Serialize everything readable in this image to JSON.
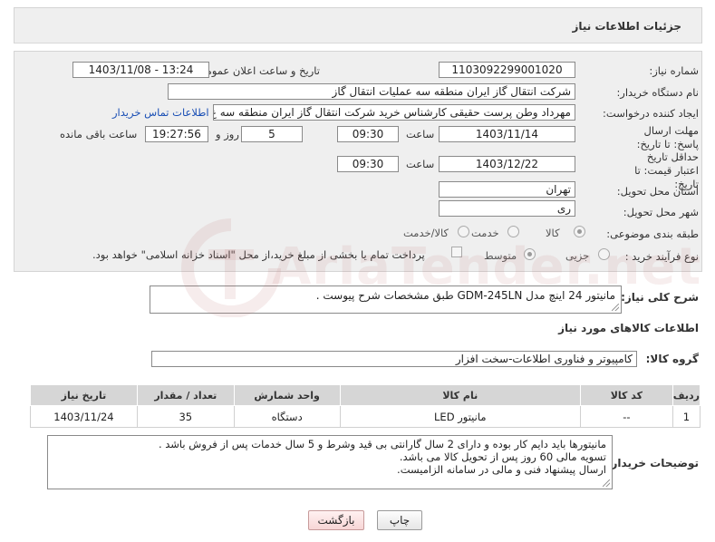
{
  "header": {
    "title": "جزئیات اطلاعات نیاز"
  },
  "form": {
    "need_number": {
      "label": "شماره نیاز:",
      "value": "1103092299001020"
    },
    "announce_datetime": {
      "label": "تاریخ و ساعت اعلان عمومی:",
      "value": "1403/11/08 - 13:24"
    },
    "buyer_org": {
      "label": "نام دستگاه خریدار:",
      "value": "شرکت انتقال گاز ایران منطقه سه عملیات انتقال گاز"
    },
    "requester": {
      "label": "ایجاد کننده درخواست:",
      "value": "مهرداد وطن پرست حقیقی کارشناس خرید شرکت انتقال گاز ایران منطقه سه ع",
      "link": "اطلاعات تماس خریدار"
    },
    "deadline": {
      "label": "مهلت ارسال پاسخ: تا تاریخ:",
      "date": "1403/11/14",
      "time_label": "ساعت",
      "time": "09:30",
      "days": "5",
      "days_label": "روز و",
      "remaining": "19:27:56",
      "remaining_label": "ساعت باقی مانده"
    },
    "price_validity": {
      "label": "حداقل تاریخ اعتبار قیمت: تا تاریخ:",
      "date": "1403/12/22",
      "time_label": "ساعت",
      "time": "09:30"
    },
    "province": {
      "label": "استان محل تحویل:",
      "value": "تهران"
    },
    "city": {
      "label": "شهر محل تحویل:",
      "value": "ری"
    },
    "category": {
      "label": "طبقه بندی موضوعی:",
      "options": [
        "کالا",
        "خدمت",
        "کالا/خدمت"
      ],
      "selected": "کالا"
    },
    "process_type": {
      "label": "نوع فرآیند خرید :",
      "options": [
        "جزیی",
        "متوسط"
      ],
      "selected": "متوسط",
      "note": "پرداخت تمام یا بخشی از مبلغ خرید،از محل \"اسناد خزانه اسلامی\" خواهد بود."
    }
  },
  "summary": {
    "label": "شرح کلی نیاز:",
    "value": "مانیتور 24 اینچ مدل GDM-245LN طبق مشخصات شرح پیوست ."
  },
  "goods_info": {
    "title": "اطلاعات کالاهای مورد نیاز",
    "group_label": "گروه کالا:",
    "group_value": "کامپیوتر و فناوری اطلاعات-سخت افزار"
  },
  "table": {
    "headers": [
      "ردیف",
      "کد کالا",
      "نام کالا",
      "واحد شمارش",
      "تعداد / مقدار",
      "تاریخ نیاز"
    ],
    "rows": [
      [
        "1",
        "--",
        "مانیتور LED",
        "دستگاه",
        "35",
        "1403/11/24"
      ]
    ]
  },
  "buyer_notes": {
    "label": "توضیحات خریدار:",
    "lines": [
      "مانیتورها باید دایم کار بوده و دارای 2 سال گارانتی بی قید وشرط و 5 سال خدمات پس از فروش باشد .",
      "تسویه مالی 60 روز پس از تحویل کالا می باشد.",
      "ارسال پیشنهاد فنی و مالی در سامانه الزامیست."
    ]
  },
  "buttons": {
    "print": "چاپ",
    "back": "بازگشت"
  },
  "watermark": {
    "text": "AriaTender.net"
  }
}
